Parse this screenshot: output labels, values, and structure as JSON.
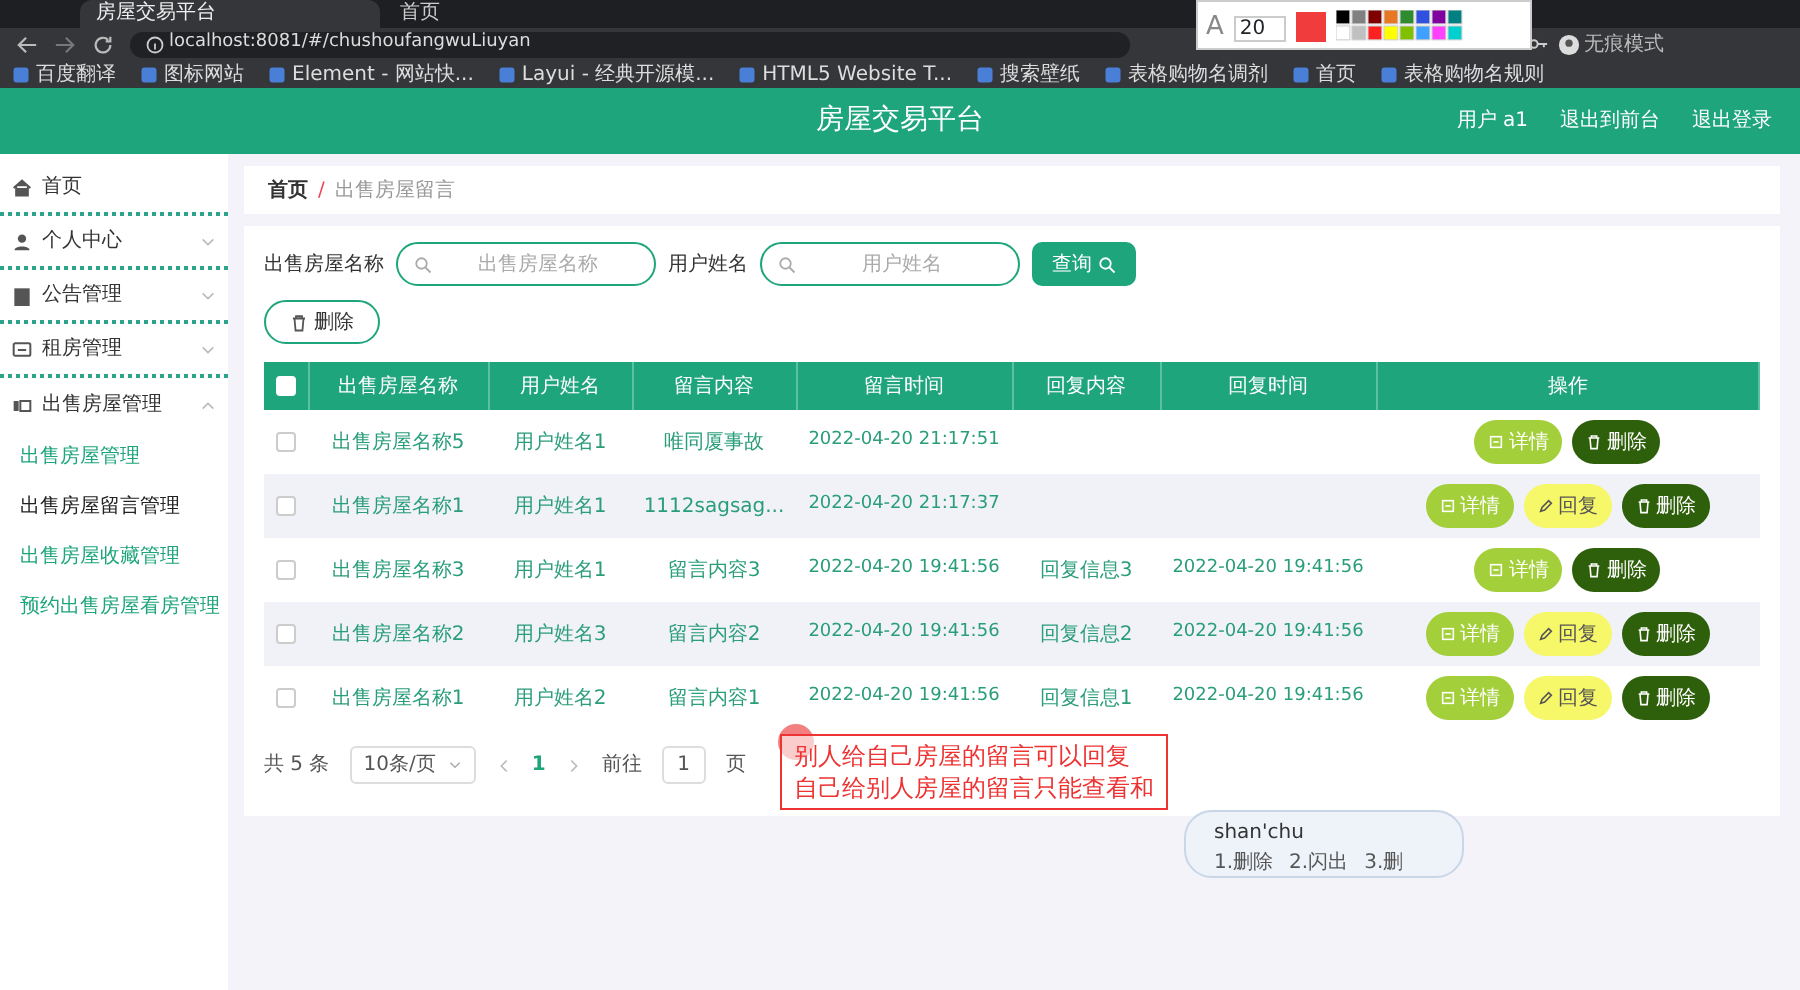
{
  "browser": {
    "tabs": [
      {
        "title": "房屋交易平台",
        "selected": true
      },
      {
        "title": "首页",
        "selected": false
      }
    ],
    "url": "localhost:8081/#/chushoufangwuLiuyan",
    "bookmarks": [
      "百度翻译",
      "图标网站",
      "Element - 网站快...",
      "Layui - 经典开源模...",
      "HTML5 Website T...",
      "搜索壁纸",
      "表格购物名调剂",
      "首页",
      "表格购物名规则"
    ],
    "profile": "无痕模式",
    "annotation_toolbar": {
      "text_tool": "A",
      "font_size": "20"
    }
  },
  "header": {
    "title": "房屋交易平台",
    "user": "用户 a1",
    "links": [
      "退出到前台",
      "退出登录"
    ]
  },
  "sidebar": {
    "items": [
      {
        "label": "首页"
      },
      {
        "label": "个人中心",
        "expanded": false
      },
      {
        "label": "公告管理",
        "expanded": false
      },
      {
        "label": "租房管理",
        "expanded": false
      },
      {
        "label": "出售房屋管理",
        "expanded": true,
        "children": [
          {
            "label": "出售房屋管理",
            "selected": false
          },
          {
            "label": "出售房屋留言管理",
            "selected": true
          },
          {
            "label": "出售房屋收藏管理",
            "selected": false
          },
          {
            "label": "预约出售房屋看房管理",
            "selected": false
          }
        ]
      }
    ]
  },
  "breadcrumb": [
    "首页",
    "出售房屋留言"
  ],
  "breadcrumb_separator": "/",
  "search": {
    "fields": [
      {
        "label": "出售房屋名称",
        "placeholder": "出售房屋名称"
      },
      {
        "label": "用户姓名",
        "placeholder": "用户姓名"
      }
    ],
    "button": "查询"
  },
  "delete_button": "删除",
  "table": {
    "header_checked": false,
    "columns": [
      "出售房屋名称",
      "用户姓名",
      "留言内容",
      "留言时间",
      "回复内容",
      "回复时间",
      "操作"
    ],
    "rows": [
      {
        "checked": false,
        "cells": [
          "出售房屋名称5",
          "用户姓名1",
          "唯同厦事故",
          "2022-04-20 21:17:51",
          "",
          ""
        ],
        "actions": [
          {
            "kind": "detail",
            "label": "详情"
          },
          {
            "kind": "delete",
            "label": "删除"
          }
        ]
      },
      {
        "checked": false,
        "cells": [
          "出售房屋名称1",
          "用户姓名1",
          "1112sagsag...",
          "2022-04-20 21:17:37",
          "",
          ""
        ],
        "actions": [
          {
            "kind": "detail",
            "label": "详情"
          },
          {
            "kind": "reply",
            "label": "回复"
          },
          {
            "kind": "delete",
            "label": "删除"
          }
        ]
      },
      {
        "checked": false,
        "cells": [
          "出售房屋名称3",
          "用户姓名1",
          "留言内容3",
          "2022-04-20 19:41:56",
          "回复信息3",
          "2022-04-20 19:41:56"
        ],
        "actions": [
          {
            "kind": "detail",
            "label": "详情"
          },
          {
            "kind": "delete",
            "label": "删除"
          }
        ]
      },
      {
        "checked": false,
        "cells": [
          "出售房屋名称2",
          "用户姓名3",
          "留言内容2",
          "2022-04-20 19:41:56",
          "回复信息2",
          "2022-04-20 19:41:56"
        ],
        "actions": [
          {
            "kind": "detail",
            "label": "详情"
          },
          {
            "kind": "reply",
            "label": "回复"
          },
          {
            "kind": "delete",
            "label": "删除"
          }
        ]
      },
      {
        "checked": false,
        "cells": [
          "出售房屋名称1",
          "用户姓名2",
          "留言内容1",
          "2022-04-20 19:41:56",
          "回复信息1",
          "2022-04-20 19:41:56"
        ],
        "actions": [
          {
            "kind": "detail",
            "label": "详情"
          },
          {
            "kind": "reply",
            "label": "回复"
          },
          {
            "kind": "delete",
            "label": "删除"
          }
        ]
      }
    ]
  },
  "pagination": {
    "total": "共 5 条",
    "page_size": "10条/页",
    "pages": [
      {
        "label": "1",
        "selected": true
      }
    ],
    "goto_label": "前往",
    "goto_value": "1",
    "goto_suffix": "页"
  },
  "annotation": {
    "lines": [
      "别人给自己房屋的留言可以回复",
      "自己给别人房屋的留言只能查看和"
    ]
  },
  "ime": {
    "input": "shan'chu",
    "candidates": [
      "1.删除",
      "2.闪出",
      "3.删"
    ]
  }
}
